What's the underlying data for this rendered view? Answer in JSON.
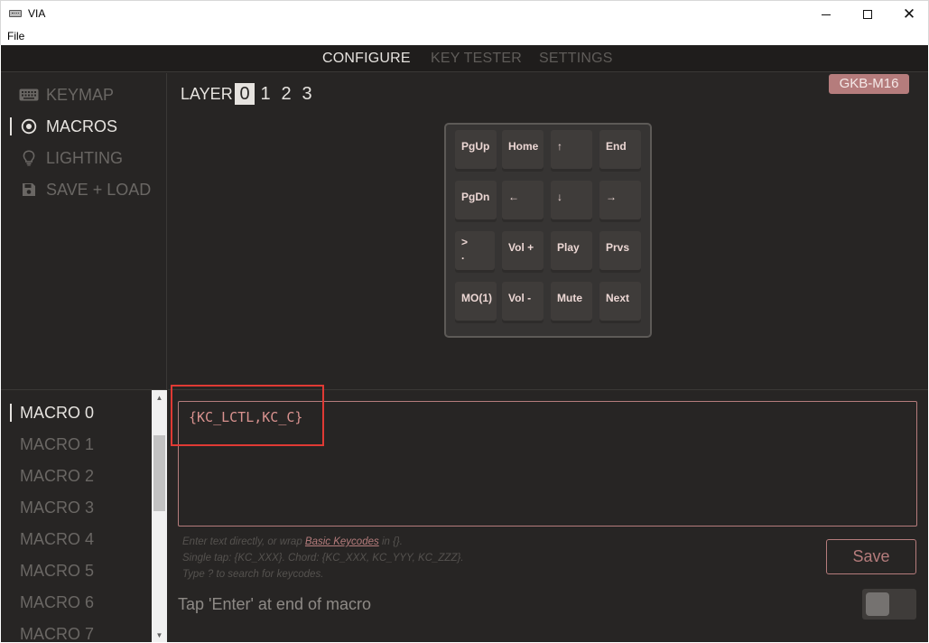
{
  "window": {
    "title": "VIA",
    "menu_file": "File",
    "minimize": "minimize",
    "maximize": "maximize",
    "close": "✕"
  },
  "nav": {
    "tabs": [
      {
        "label": "CONFIGURE",
        "active": true
      },
      {
        "label": "KEY TESTER",
        "active": false
      },
      {
        "label": "SETTINGS",
        "active": false
      }
    ]
  },
  "sidebar": {
    "items": [
      {
        "label": "KEYMAP",
        "icon": "keyboard-icon",
        "active": false
      },
      {
        "label": "MACROS",
        "icon": "target-icon",
        "active": true
      },
      {
        "label": "LIGHTING",
        "icon": "lightbulb-icon",
        "active": false
      },
      {
        "label": "SAVE + LOAD",
        "icon": "floppy-disk-icon",
        "active": false
      }
    ]
  },
  "keyboard": {
    "layer_label": "LAYER",
    "layers": [
      "0",
      "1",
      "2",
      "3"
    ],
    "active_layer": "0",
    "device": "GKB-M16",
    "keys": [
      [
        "PgUp",
        "Home",
        "↑",
        "End"
      ],
      [
        "PgDn",
        "←",
        "↓",
        "→"
      ],
      [
        "> .",
        "Vol +",
        "Play",
        "Prvs"
      ],
      [
        "MO(1)",
        "Vol -",
        "Mute",
        "Next"
      ]
    ]
  },
  "macros": {
    "items": [
      "MACRO 0",
      "MACRO 1",
      "MACRO 2",
      "MACRO 3",
      "MACRO 4",
      "MACRO 5",
      "MACRO 6",
      "MACRO 7"
    ],
    "active_index": 0,
    "editor_value": "{KC_LCTL,KC_C}",
    "help_line1_before": "Enter text directly, or wrap ",
    "help_link": "Basic Keycodes",
    "help_line1_after": " in {}.",
    "help_line2": "Single tap: {KC_XXX}. Chord: {KC_XXX, KC_YYY, KC_ZZZ}.",
    "help_line3": "Type ? to search for keycodes.",
    "save_label": "Save",
    "enter_label": "Tap 'Enter' at end of macro",
    "enter_toggle_on": false
  },
  "colors": {
    "accent": "#b57c7c",
    "background": "#272524",
    "text_active": "#e6e3df",
    "text_inactive": "#6a6764",
    "highlight": "#e03a34"
  }
}
